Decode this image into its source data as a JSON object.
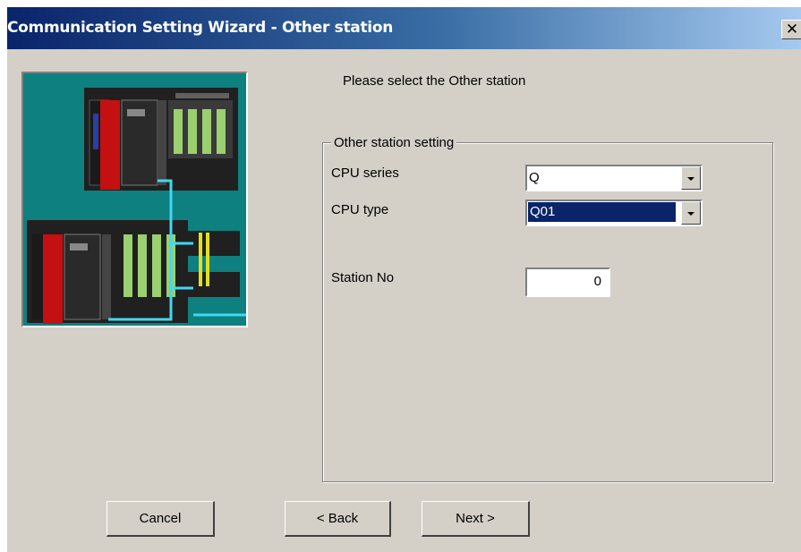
{
  "window": {
    "title": "Communication Setting Wizard - Other station",
    "close_label": "✕"
  },
  "instruction": "Please select the Other station",
  "group": {
    "legend": "Other station setting",
    "cpu_series": {
      "label": "CPU series",
      "value": "Q"
    },
    "cpu_type": {
      "label": "CPU type",
      "value": "Q01"
    },
    "station_no": {
      "label": "Station No",
      "value": "0"
    }
  },
  "buttons": {
    "cancel": "Cancel",
    "back": "< Back",
    "next": "Next >"
  }
}
